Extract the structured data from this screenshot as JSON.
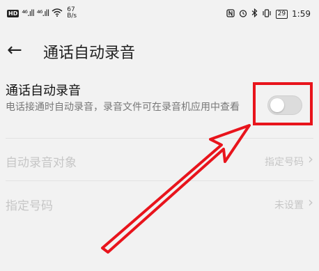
{
  "status_bar": {
    "network_left": "HD",
    "signal1": "⁴⁶.ıll",
    "signal2": "⁴⁶.ıll",
    "net_speed_value": "67",
    "net_speed_unit": "B/s",
    "time": "1:59",
    "battery": "29"
  },
  "header": {
    "back_label": "←",
    "title": "通话自动录音"
  },
  "auto_record": {
    "title": "通话自动录音",
    "description": "电话接通时自动录音，录音文件可在录音机应用中查看",
    "enabled": false
  },
  "rows": [
    {
      "label": "自动录音对象",
      "value": "指定号码",
      "chevron": "›"
    },
    {
      "label": "指定号码",
      "value": "未设置",
      "chevron": "›"
    }
  ],
  "colors": {
    "highlight": "#e8141c",
    "arrow": "#e8141c"
  }
}
